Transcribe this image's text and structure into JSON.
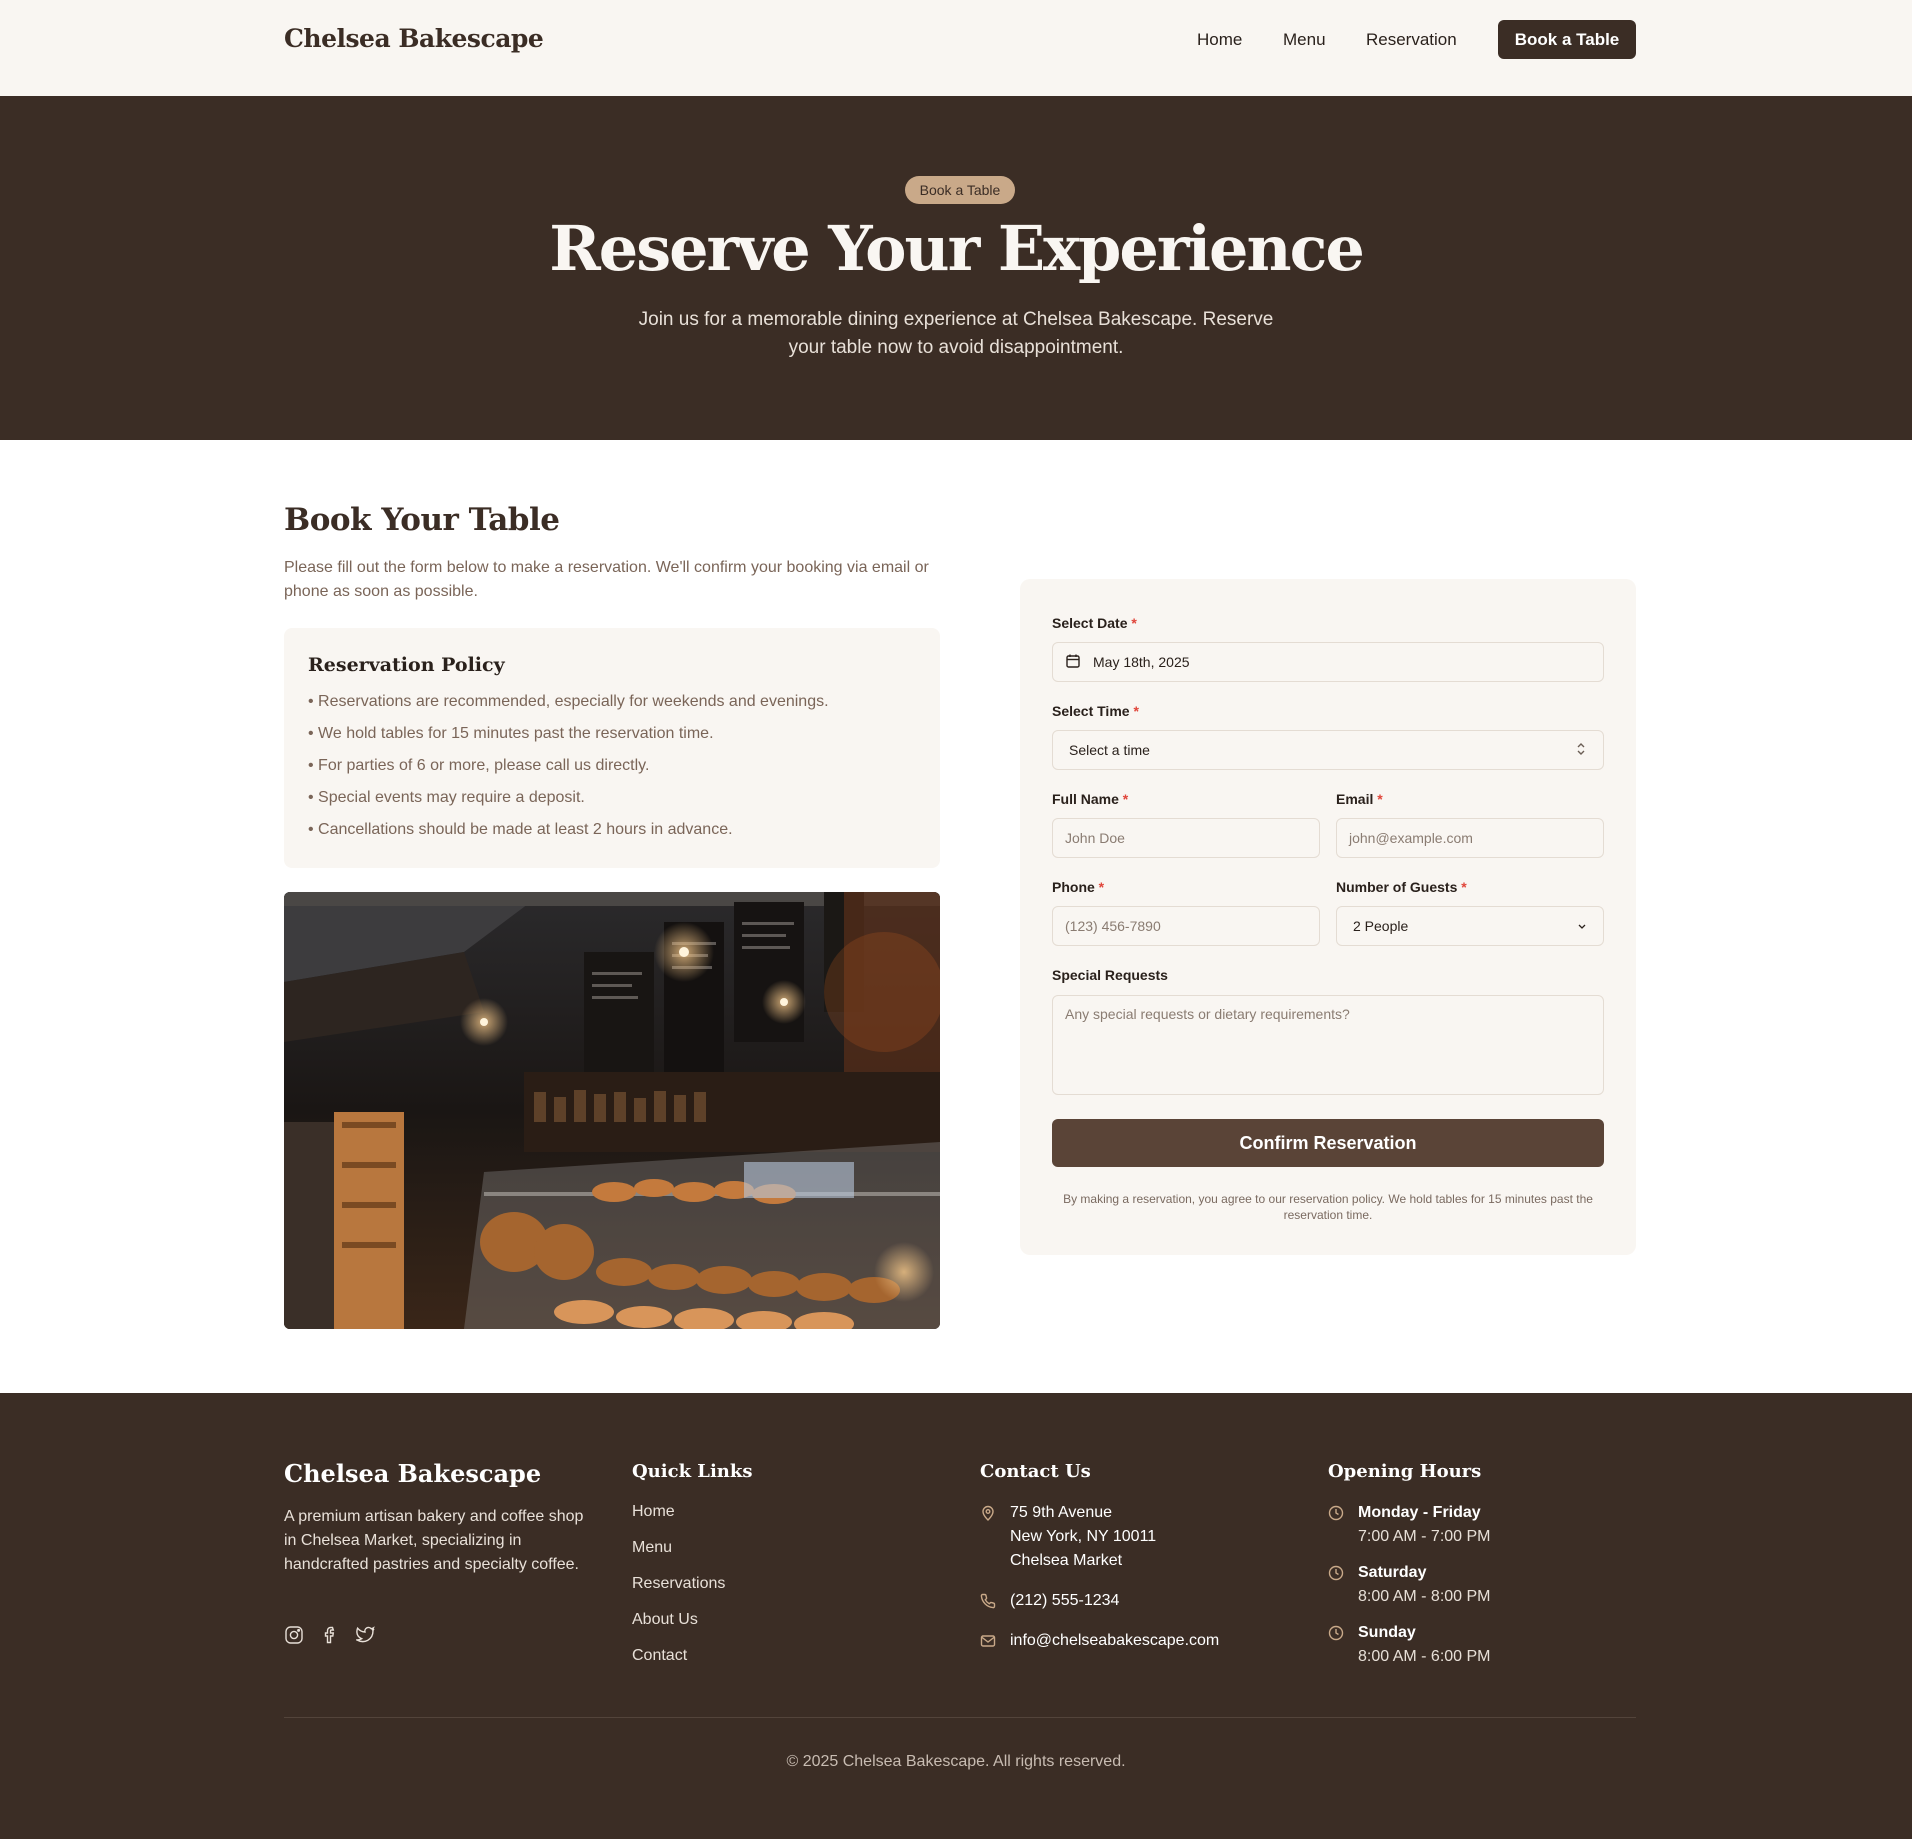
{
  "header": {
    "brand": "Chelsea Bakescape",
    "nav": [
      "Home",
      "Menu",
      "Reservation"
    ],
    "cta": "Book a Table"
  },
  "hero": {
    "badge": "Book a Table",
    "title": "Reserve Your Experience",
    "subtitle": "Join us for a memorable dining experience at Chelsea Bakescape. Reserve your table now to avoid disappointment."
  },
  "booking": {
    "title": "Book Your Table",
    "description": "Please fill out the form below to make a reservation. We'll confirm your booking via email or phone as soon as possible.",
    "policy_title": "Reservation Policy",
    "policy_items": [
      "• Reservations are recommended, especially for weekends and evenings.",
      "• We hold tables for 15 minutes past the reservation time.",
      "• For parties of 6 or more, please call us directly.",
      "• Special events may require a deposit.",
      "• Cancellations should be made at least 2 hours in advance."
    ]
  },
  "form": {
    "date_label": "Select Date",
    "date_value": "May 18th, 2025",
    "time_label": "Select Time",
    "time_value": "Select a time",
    "name_label": "Full Name",
    "name_placeholder": "John Doe",
    "email_label": "Email",
    "email_placeholder": "john@example.com",
    "phone_label": "Phone",
    "phone_placeholder": "(123) 456-7890",
    "guests_label": "Number of Guests",
    "guests_value": "2 People",
    "requests_label": "Special Requests",
    "requests_placeholder": "Any special requests or dietary requirements?",
    "required_mark": "*",
    "submit": "Confirm Reservation",
    "fine_print": "By making a reservation, you agree to our reservation policy. We hold tables for 15 minutes past the reservation time."
  },
  "footer": {
    "brand": "Chelsea Bakescape",
    "about": "A premium artisan bakery and coffee shop in Chelsea Market, specializing in handcrafted pastries and specialty coffee.",
    "social_icons": [
      "instagram-icon",
      "facebook-icon",
      "twitter-icon"
    ],
    "quick_links_title": "Quick Links",
    "quick_links": [
      "Home",
      "Menu",
      "Reservations",
      "About Us",
      "Contact"
    ],
    "contact_title": "Contact Us",
    "address": [
      "75 9th Avenue",
      "New York, NY 10011",
      "Chelsea Market"
    ],
    "phone": "(212) 555-1234",
    "email": "info@chelseabakescape.com",
    "hours_title": "Opening Hours",
    "hours": [
      {
        "day": "Monday - Friday",
        "time": "7:00 AM - 7:00 PM"
      },
      {
        "day": "Saturday",
        "time": "8:00 AM - 8:00 PM"
      },
      {
        "day": "Sunday",
        "time": "8:00 AM - 6:00 PM"
      }
    ],
    "copyright": "© 2025 Chelsea Bakescape. All rights reserved."
  },
  "colors": {
    "dark_brown": "#3b2d25",
    "cream": "#f9f6f2",
    "tan": "#c9a989",
    "button_brown": "#5a4437",
    "required_red": "#e0453a"
  }
}
